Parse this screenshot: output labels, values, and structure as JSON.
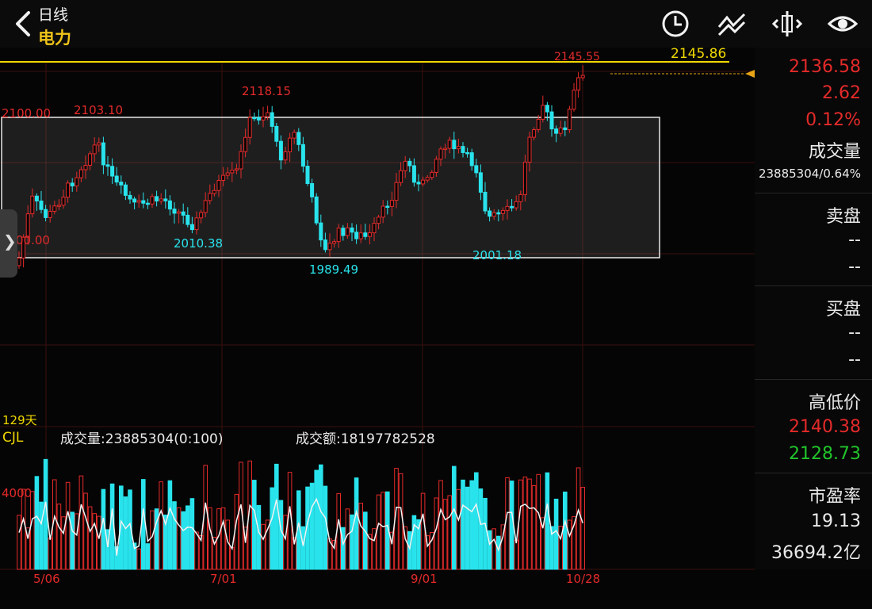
{
  "header": {
    "back_label": "<",
    "period_label": "日线",
    "stock_name": "电力",
    "icons": [
      "clock-icon",
      "line-draw-icon",
      "split-view-icon",
      "eye-icon"
    ]
  },
  "chart": {
    "line_label": "2145.86",
    "high_label": "2145.55",
    "box_top_label": "2100.00",
    "box_bottom_partial_label": "00.00",
    "peak_labels": [
      "2103.10",
      "2118.15"
    ],
    "trough_labels": [
      "2010.38",
      "1989.49",
      "2001.18"
    ],
    "date_labels": [
      "5/06",
      "7/01",
      "9/01",
      "10/28"
    ],
    "days_label": "129天",
    "indicator_name": "CJL",
    "volume_text": "成交量:23885304(0:100)",
    "amount_text": "成交额:18197782528",
    "volume_axis_label": "4000"
  },
  "sidebar": {
    "price": "2136.58",
    "change": "2.62",
    "change_pct": "0.12%",
    "volume_label": "成交量",
    "volume_value": "23885304/0.64%",
    "sell_label": "卖盘",
    "sell_values": [
      "--",
      "--"
    ],
    "buy_label": "买盘",
    "buy_values": [
      "--",
      "--"
    ],
    "highlow_label": "高低价",
    "high": "2140.38",
    "low": "2128.73",
    "pe_label": "市盈率",
    "pe_value": "19.13",
    "market_cap": "36694.2亿"
  },
  "colors": {
    "up": "#e42a2a",
    "down": "#29e3ec",
    "yellow_line": "#f0d800",
    "orange_arrow": "#e8a317",
    "up_green": "#21c52b"
  }
}
